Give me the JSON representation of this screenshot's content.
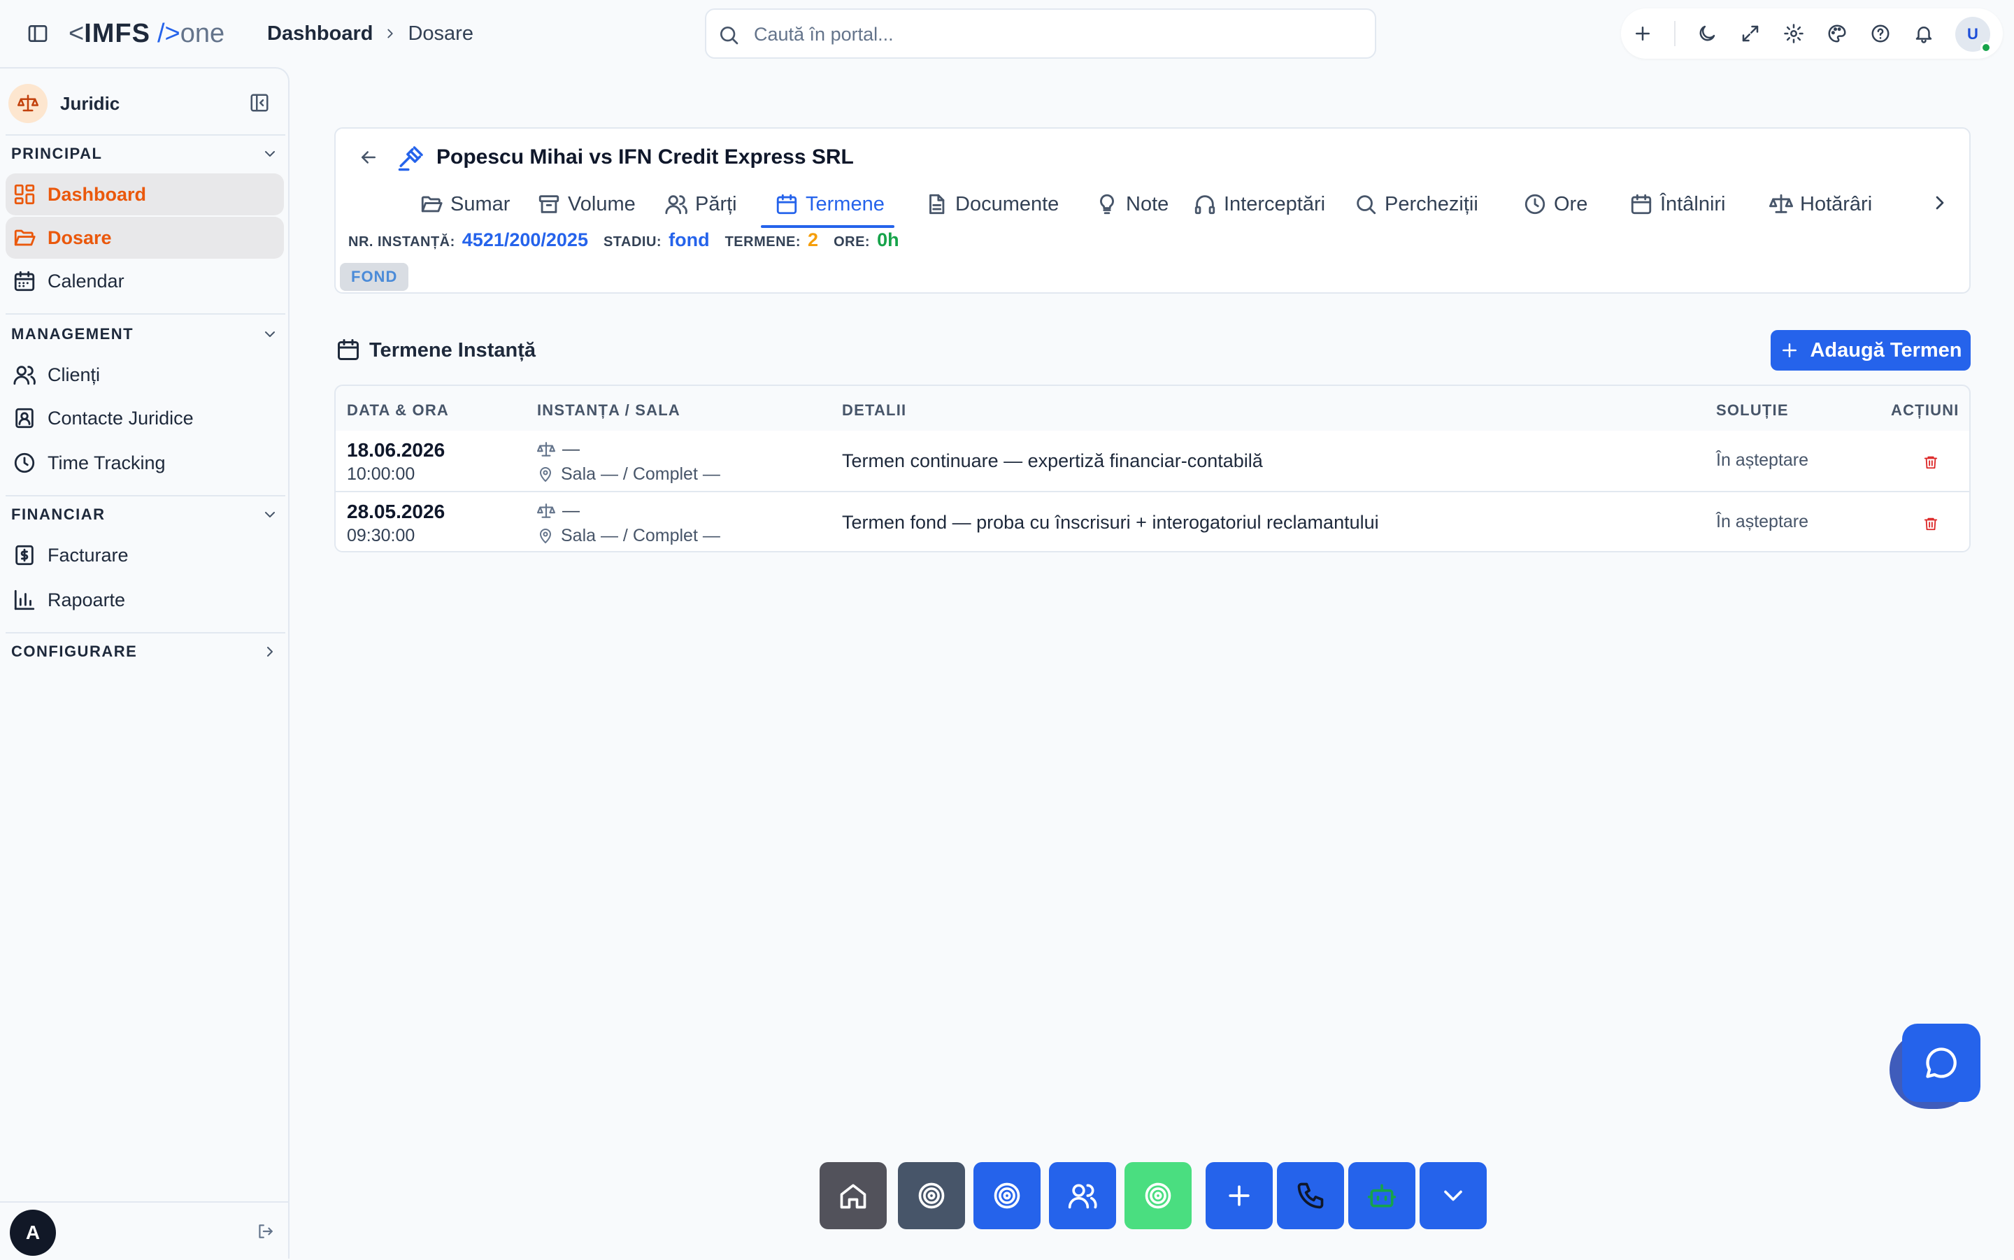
{
  "app": {
    "brand_lt": "<",
    "brand_name": "IMFS",
    "brand_slash": "/>",
    "brand_suffix": "one"
  },
  "breadcrumb": [
    "Dashboard",
    "Dosare"
  ],
  "search": {
    "placeholder": "Caută în portal..."
  },
  "top_actions": {
    "icons": [
      "plus-icon",
      "moon-icon",
      "expand-icon",
      "gear-icon",
      "palette-icon",
      "help-icon",
      "bell-icon"
    ],
    "avatar_initial": "U",
    "status_color": "#16a34a"
  },
  "sidebar": {
    "module_name": "Juridic",
    "sections": [
      {
        "title": "PRINCIPAL",
        "items": [
          {
            "label": "Dashboard",
            "icon": "dashboard-icon",
            "active": true
          },
          {
            "label": "Dosare",
            "icon": "folder-open-icon",
            "active": true
          },
          {
            "label": "Calendar",
            "icon": "calendar-icon",
            "active": false
          }
        ]
      },
      {
        "title": "MANAGEMENT",
        "items": [
          {
            "label": "Clienți",
            "icon": "users-icon"
          },
          {
            "label": "Contacte Juridice",
            "icon": "contact-icon"
          },
          {
            "label": "Time Tracking",
            "icon": "clock-icon"
          }
        ]
      },
      {
        "title": "FINANCIAR",
        "items": [
          {
            "label": "Facturare",
            "icon": "invoice-icon"
          },
          {
            "label": "Rapoarte",
            "icon": "bar-chart-icon"
          }
        ]
      },
      {
        "title": "CONFIGURARE",
        "items": []
      }
    ],
    "user_initial": "A",
    "active_color": "#ea580c"
  },
  "case": {
    "title": "Popescu Mihai vs IFN Credit Express SRL",
    "tabs": [
      {
        "label": "Sumar",
        "icon": "folder-icon"
      },
      {
        "label": "Volume",
        "icon": "archive-icon"
      },
      {
        "label": "Părți",
        "icon": "users-icon"
      },
      {
        "label": "Termene",
        "icon": "calendar-icon",
        "active": true
      },
      {
        "label": "Documente",
        "icon": "document-icon"
      },
      {
        "label": "Note",
        "icon": "lightbulb-icon"
      },
      {
        "label": "Interceptări",
        "icon": "headphones-icon"
      },
      {
        "label": "Percheziții",
        "icon": "search-icon"
      },
      {
        "label": "Ore",
        "icon": "clock-icon"
      },
      {
        "label": "Întâlniri",
        "icon": "calendar-icon"
      },
      {
        "label": "Hotărâri",
        "icon": "scale-icon"
      }
    ],
    "meta": {
      "nr_label": "NR. INSTANȚĂ:",
      "nr_value": "4521/200/2025",
      "nr_color": "#2563eb",
      "stadiu_label": "STADIU:",
      "stadiu_value": "fond",
      "stadiu_color": "#2563eb",
      "termene_label": "TERMENE:",
      "termene_value": "2",
      "termene_color": "#f59e0b",
      "ore_label": "ORE:",
      "ore_value": "0h",
      "ore_color": "#16a34a"
    },
    "badge": "FOND"
  },
  "terms": {
    "title": "Termene Instanță",
    "add_label": "Adaugă Termen",
    "columns": [
      "DATA & ORA",
      "INSTANȚA / SALA",
      "DETALII",
      "SOLUȚIE",
      "ACȚIUNI"
    ],
    "rows": [
      {
        "date": "18.06.2026",
        "time": "10:00:00",
        "court": "—",
        "room": "Sala — / Complet —",
        "details": "Termen continuare — expertiză financiar-contabilă",
        "solution": "În așteptare"
      },
      {
        "date": "28.05.2026",
        "time": "09:30:00",
        "court": "—",
        "room": "Sala — / Complet —",
        "details": "Termen fond — proba cu înscrisuri + interogatoriul reclamantului",
        "solution": "În așteptare"
      }
    ]
  },
  "dock": [
    {
      "icon": "home-icon",
      "color": "#52525b"
    },
    {
      "icon": "target-icon",
      "color": "#475569"
    },
    {
      "icon": "target-icon",
      "color": "#2563eb"
    },
    {
      "icon": "users-icon",
      "color": "#2563eb"
    },
    {
      "icon": "target-icon",
      "color": "#4ade80"
    },
    {
      "icon": "plus-icon",
      "color": "#2563eb"
    },
    {
      "icon": "phone-icon",
      "color": "#2563eb"
    },
    {
      "icon": "bot-icon",
      "color": "#2563eb"
    },
    {
      "icon": "chevron-down-icon",
      "color": "#2563eb"
    }
  ]
}
